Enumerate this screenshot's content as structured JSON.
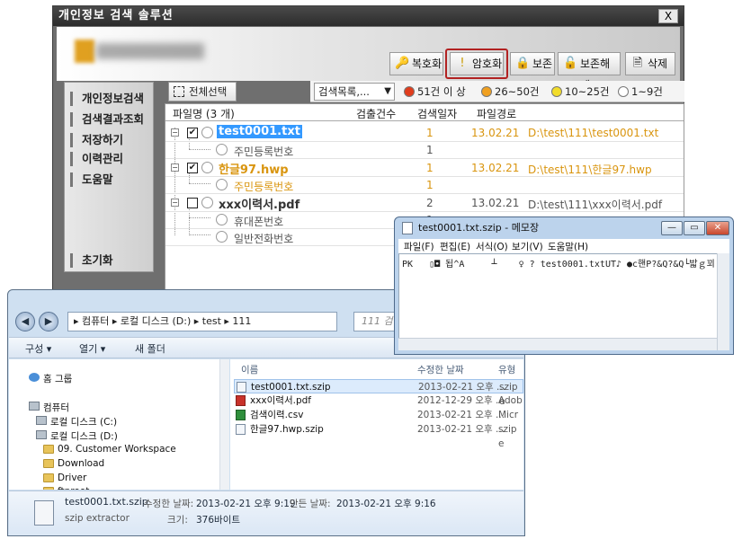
{
  "app": {
    "title": "개인정보 검색 솔루션",
    "close": "X",
    "toolbar": {
      "decrypt": "복호화",
      "encrypt": "암호화",
      "protect": "보존",
      "unprotect": "보존해제",
      "delete": "삭제"
    },
    "sidebar": [
      "개인정보검색",
      "검색결과조회",
      "저장하기",
      "이력관리",
      "도움말",
      "초기화"
    ],
    "select_all": "전체선택",
    "dropdown": "검색목록,...",
    "legend": [
      {
        "label": "51건 이 상",
        "color": "#e03c1c"
      },
      {
        "label": "26~50건",
        "color": "#f0a020"
      },
      {
        "label": "10~25건",
        "color": "#f2dc2a"
      },
      {
        "label": "1~9건",
        "color": "#ffffff"
      }
    ],
    "list": {
      "headers": {
        "name": "파일명 (3 개)",
        "count": "검출건수",
        "date": "검색일자",
        "path": "파일경로"
      },
      "files": [
        {
          "name": "test0001.txt",
          "checked": "✔",
          "count": "1",
          "date": "13.02.21",
          "path": "D:\\test\\111\\test0001.txt",
          "sub": [
            {
              "name": "주민등록번호",
              "count": "1"
            }
          ]
        },
        {
          "name": "한글97.hwp",
          "checked": "✔",
          "count": "1",
          "date": "13.02.21",
          "path": "D:\\test\\111\\한글97.hwp",
          "sub": [
            {
              "name": "주민등록번호",
              "count": "1"
            }
          ]
        },
        {
          "name": "xxx이력서.pdf",
          "checked": "",
          "count": "2",
          "date": "13.02.21",
          "path": "D:\\test\\111\\xxx이력서.pdf",
          "sub": [
            {
              "name": "휴대폰번호",
              "count": "1"
            },
            {
              "name": "일반전화번호",
              "count": "1"
            }
          ]
        }
      ]
    }
  },
  "explorer": {
    "breadcrumb": "▸ 컴퓨터 ▸ 로컬 디스크 (D:) ▸ test ▸ 111",
    "search_placeholder": "111 검색",
    "commands": {
      "organize": "구성 ▾",
      "open": "열기 ▾",
      "new_folder": "새 폴더"
    },
    "nav": {
      "homegroup": "홈 그룹",
      "computer": "컴퓨터",
      "drive_c": "로컬 디스크 (C:)",
      "drive_d": "로컬 디스크 (D:)",
      "folders": [
        "09. Customer Workspace",
        "Download",
        "Driver",
        "ftproot"
      ]
    },
    "columns": {
      "name": "이름",
      "modified": "수정한 날짜",
      "type": "유형"
    },
    "files": [
      {
        "name": "test0001.txt.szip",
        "modified": "2013-02-21 오후 ...",
        "type": "szip e"
      },
      {
        "name": "xxx이력서.pdf",
        "modified": "2012-12-29 오후 ...",
        "type": "Adob"
      },
      {
        "name": "검색이력.csv",
        "modified": "2013-02-21 오후 ...",
        "type": "Micr"
      },
      {
        "name": "한글97.hwp.szip",
        "modified": "2013-02-21 오후 ...",
        "type": "szip e"
      }
    ],
    "details": {
      "filename": "test0001.txt.szip",
      "modified_label": "수정한 날짜:",
      "modified_value": "2013-02-21 오후 9:19",
      "created_label": "만든 날짜:",
      "created_value": "2013-02-21 오후 9:16",
      "type": "szip extractor",
      "size_label": "크기:",
      "size_value": "376바이트"
    }
  },
  "notepad": {
    "title": "test0001.txt.szip - 메모장",
    "menu": [
      "파일(F)",
      "편집(E)",
      "서식(O)",
      "보기(V)",
      "도움말(H)"
    ],
    "content": "PK   ▯◘ 됩^A     ┴    ♀ ? test0001.txtUT♪ ●c핸P?&Q?&Q└밟ｇ꾀|'"
  }
}
